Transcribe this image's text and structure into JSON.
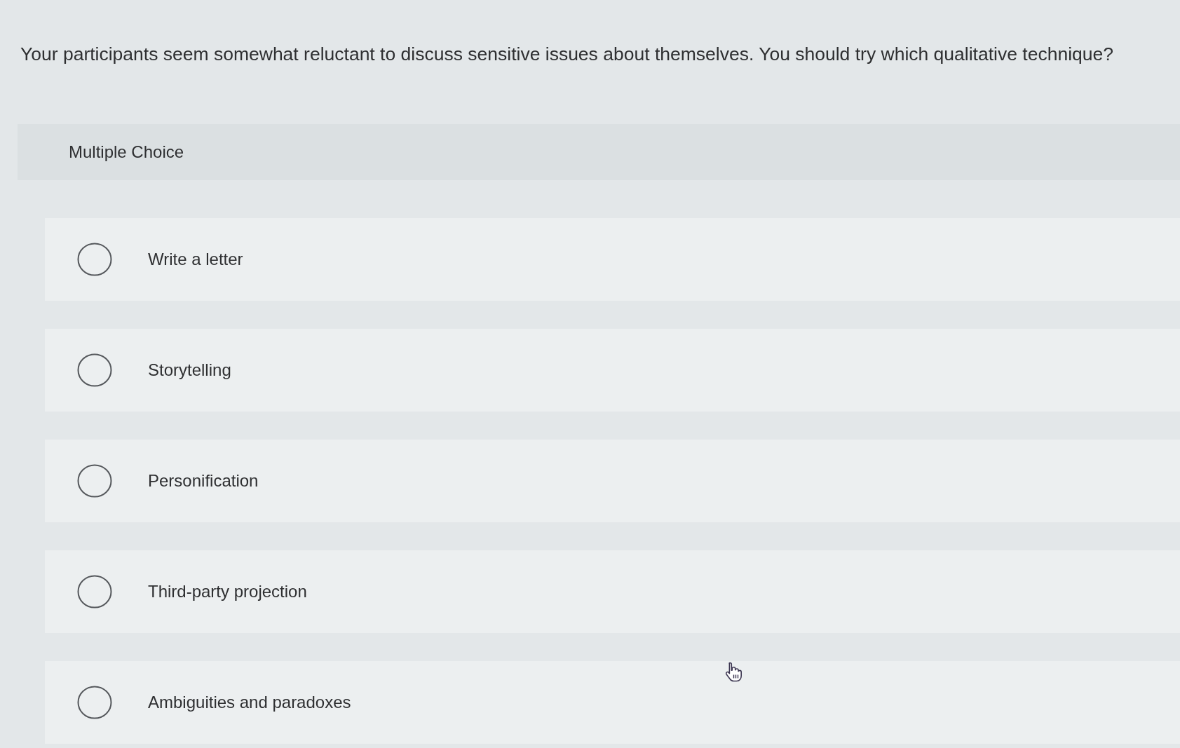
{
  "question": {
    "text": "Your participants seem somewhat reluctant to discuss sensitive issues about themselves. You should try which qualitative technique?"
  },
  "answer_panel": {
    "type_label": "Multiple Choice",
    "options": [
      {
        "label": "Write a letter",
        "selected": false
      },
      {
        "label": "Storytelling",
        "selected": false
      },
      {
        "label": "Personification",
        "selected": false
      },
      {
        "label": "Third-party projection",
        "selected": false
      },
      {
        "label": "Ambiguities and paradoxes",
        "selected": false
      }
    ]
  }
}
